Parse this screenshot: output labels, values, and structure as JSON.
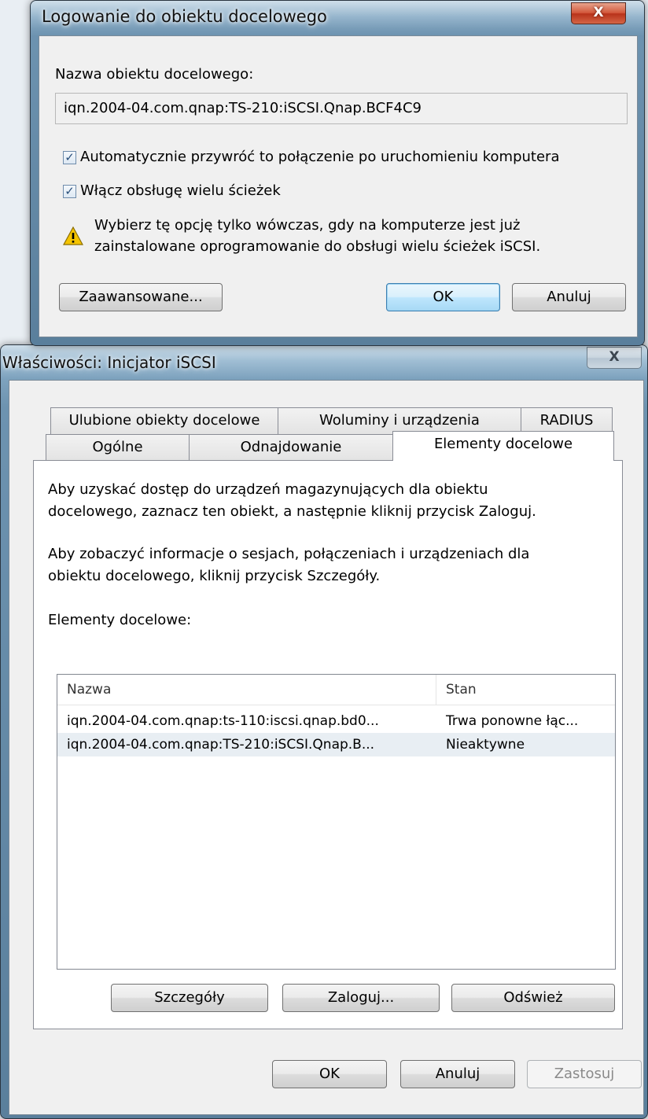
{
  "login_dialog": {
    "title": "Logowanie do obiektu docelowego",
    "close_glyph": "X",
    "target_name_label": "Nazwa obiektu docelowego:",
    "target_name_value": "iqn.2004-04.com.qnap:TS-210:iSCSI.Qnap.BCF4C9",
    "auto_restore": {
      "label": "Automatycznie przywróć to połączenie po uruchomieniu komputera",
      "checked": true
    },
    "multipath": {
      "label": "Włącz obsługę wielu ścieżek",
      "checked": true
    },
    "warning_line1": "Wybierz tę opcję tylko wówczas, gdy na komputerze jest już",
    "warning_line2": "zainstalowane oprogramowanie do obsługi wielu ścieżek iSCSI.",
    "advanced_label": "Zaawansowane...",
    "ok_label": "OK",
    "cancel_label": "Anuluj"
  },
  "properties_dialog": {
    "title": "Właściwości: Inicjator iSCSI",
    "close_glyph": "X",
    "tabs_back": [
      "Ulubione obiekty docelowe",
      "Woluminy i urządzenia",
      "RADIUS"
    ],
    "tabs_front": [
      "Ogólne",
      "Odnajdowanie",
      "Elementy docelowe"
    ],
    "active_tab": "Elementy docelowe",
    "info1_line1": "Aby uzyskać dostęp do urządzeń magazynujących dla obiektu",
    "info1_line2": "docelowego, zaznacz ten obiekt, a następnie kliknij przycisk Zaloguj.",
    "info2_line1": "Aby zobaczyć informacje o sesjach, połączeniach i urządzeniach dla",
    "info2_line2": "obiektu docelowego, kliknij przycisk Szczegóły.",
    "targets_label": "Elementy docelowe:",
    "columns": [
      "Nazwa",
      "Stan"
    ],
    "rows": [
      {
        "name": "iqn.2004-04.com.qnap:ts-110:iscsi.qnap.bd0...",
        "state": "Trwa ponowne łąc..."
      },
      {
        "name": "iqn.2004-04.com.qnap:TS-210:iSCSI.Qnap.B...",
        "state": "Nieaktywne"
      }
    ],
    "details_label": "Szczegóły",
    "login_label": "Zaloguj...",
    "refresh_label": "Odśwież",
    "ok_label": "OK",
    "cancel_label": "Anuluj",
    "apply_label": "Zastosuj"
  },
  "colors": {
    "frame": "#6d93b0",
    "selected_row": "#e8eef3",
    "warning": "#f5c400"
  }
}
